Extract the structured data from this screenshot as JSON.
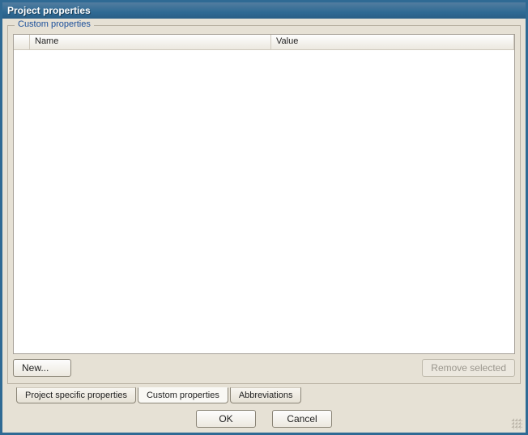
{
  "window": {
    "title": "Project properties"
  },
  "group": {
    "label": "Custom properties"
  },
  "table": {
    "columns": {
      "name": "Name",
      "value": "Value"
    },
    "rows": []
  },
  "buttons": {
    "newLabel": "New...",
    "removeLabel": "Remove selected",
    "ok": "OK",
    "cancel": "Cancel"
  },
  "tabs": {
    "items": [
      {
        "label": "Project specific properties",
        "active": false
      },
      {
        "label": "Custom properties",
        "active": true
      },
      {
        "label": "Abbreviations",
        "active": false
      }
    ]
  }
}
